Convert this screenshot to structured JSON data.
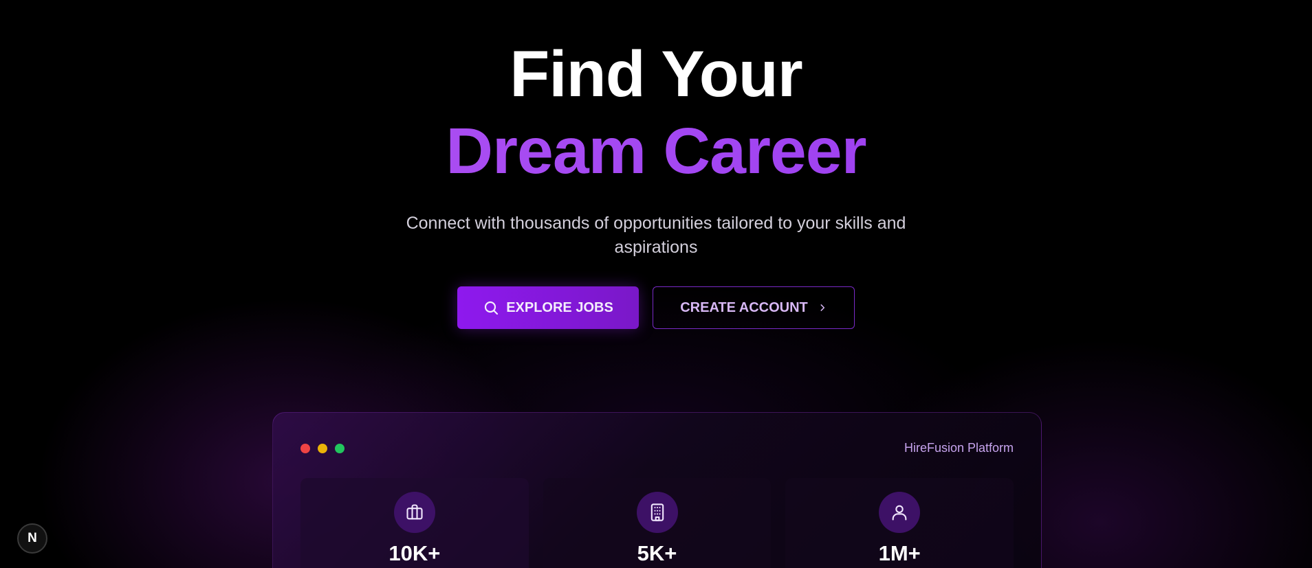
{
  "hero": {
    "title_line1": "Find Your",
    "title_line2": "Dream Career",
    "subtitle": "Connect with thousands of opportunities tailored to your skills and aspirations"
  },
  "cta": {
    "primary_label": "EXPLORE JOBS",
    "primary_icon": "search-icon",
    "secondary_label": "CREATE ACCOUNT",
    "secondary_icon": "chevron-right-icon"
  },
  "panel": {
    "label": "HireFusion Platform",
    "window_dots": [
      {
        "name": "red",
        "color": "#ef4444"
      },
      {
        "name": "yellow",
        "color": "#eab308"
      },
      {
        "name": "green",
        "color": "#22c55e"
      }
    ],
    "stats": [
      {
        "icon": "briefcase-icon",
        "value": "10K+"
      },
      {
        "icon": "building-icon",
        "value": "5K+"
      },
      {
        "icon": "user-icon",
        "value": "1M+"
      }
    ]
  },
  "badge": {
    "label": "N"
  },
  "colors": {
    "accent": "#9333ea",
    "accent_light": "#b456f0",
    "background": "#000000"
  }
}
